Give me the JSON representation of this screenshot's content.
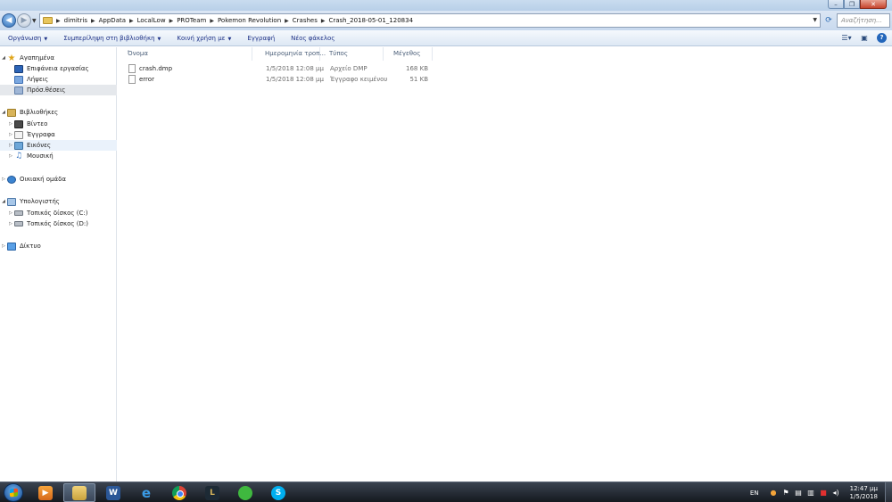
{
  "window": {
    "controls": {
      "minimize": "–",
      "maximize": "❐",
      "close": "✕"
    }
  },
  "address": {
    "crumbs": [
      "dimitris",
      "AppData",
      "LocalLow",
      "PROTeam",
      "Pokemon Revolution",
      "Crashes",
      "Crash_2018-05-01_120834"
    ],
    "search_placeholder": "Αναζήτηση..."
  },
  "toolbar": {
    "organize": "Οργάνωση",
    "include_library": "Συμπερίληψη στη βιβλιοθήκη",
    "share": "Κοινή χρήση με",
    "burn": "Εγγραφή",
    "new_folder": "Νέος φάκελος"
  },
  "nav": {
    "favorites": "Αγαπημένα",
    "desktop": "Επιφάνεια εργασίας",
    "downloads": "Λήψεις",
    "recent": "Πρόσ.θέσεις",
    "libraries": "Βιβλιοθήκες",
    "videos": "Βίντεο",
    "documents": "Έγγραφα",
    "pictures": "Εικόνες",
    "music": "Μουσική",
    "homegroup": "Οικιακή ομάδα",
    "computer": "Υπολογιστής",
    "disk_c": "Τοπικός δίσκος (C:)",
    "disk_d": "Τοπικός δίσκος (D:)",
    "network": "Δίκτυο"
  },
  "columns": {
    "name": "Όνομα",
    "date": "Ημερομηνία τροπ...",
    "type": "Τύπος",
    "size": "Μέγεθος"
  },
  "files": [
    {
      "name": "crash.dmp",
      "date": "1/5/2018 12:08 μμ",
      "type": "Αρχείο DMP",
      "size": "168 KB"
    },
    {
      "name": "error",
      "date": "1/5/2018 12:08 μμ",
      "type": "Έγγραφο κειμένου",
      "size": "51 KB"
    }
  ],
  "taskbar": {
    "word_letter": "W",
    "language": "EN",
    "time": "12:47 μμ",
    "date": "1/5/2018"
  },
  "colors": {
    "titlebar": "#c9dcef",
    "toolbar_text": "#1e3287",
    "selected_nav": "#e5e8ec",
    "taskbar": "#15191f"
  }
}
